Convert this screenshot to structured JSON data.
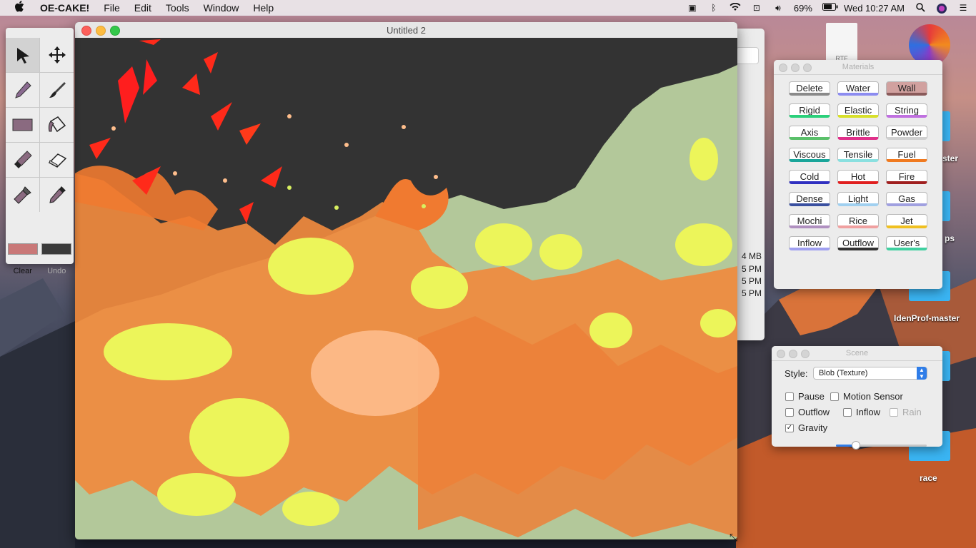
{
  "menubar": {
    "apple": "",
    "menus": [
      "OE-CAKE!",
      "File",
      "Edit",
      "Tools",
      "Window",
      "Help"
    ],
    "battery": "69%",
    "clock": "Wed 10:27 AM"
  },
  "desktop": {
    "labels": [
      "ster",
      "ps",
      "IdenProf-master",
      "race"
    ],
    "doc_badge": "RTF",
    "finder_texts": [
      "4 MB",
      "5 PM",
      "5 PM",
      "5 PM"
    ]
  },
  "tools": {
    "items": [
      "select-tool",
      "move-tool",
      "pencil-tool",
      "brush-tool",
      "rectangle-tool",
      "fill-tool",
      "knife-tool",
      "eraser-tool",
      "flashlight-tool",
      "dropper-tool"
    ],
    "primary_color": "#c97878",
    "secondary_color": "#3a3a3a",
    "clear_label": "Clear",
    "undo_label": "Undo"
  },
  "main_window": {
    "title": "Untitled 2"
  },
  "materials": {
    "title": "Materials",
    "buttons": [
      {
        "label": "Delete",
        "color": "#8a8a8a"
      },
      {
        "label": "Water",
        "color": "#8c8cf0"
      },
      {
        "label": "Wall",
        "color": "#8a5a5a"
      },
      {
        "label": "Rigid",
        "color": "#2ad07a"
      },
      {
        "label": "Elastic",
        "color": "#d8e02a"
      },
      {
        "label": "String",
        "color": "#c070e0"
      },
      {
        "label": "Axis",
        "color": "#5ac06a"
      },
      {
        "label": "Brittle",
        "color": "#e0308a"
      },
      {
        "label": "Powder",
        "color": "#d0d0d0"
      },
      {
        "label": "Viscous",
        "color": "#1aa59a"
      },
      {
        "label": "Tensile",
        "color": "#8ae0e0"
      },
      {
        "label": "Fuel",
        "color": "#f07a20"
      },
      {
        "label": "Cold",
        "color": "#3030c0"
      },
      {
        "label": "Hot",
        "color": "#e02020"
      },
      {
        "label": "Fire",
        "color": "#a02020"
      },
      {
        "label": "Dense",
        "color": "#3a50a0"
      },
      {
        "label": "Light",
        "color": "#a0d0f0"
      },
      {
        "label": "Gas",
        "color": "#a0a0e0"
      },
      {
        "label": "Mochi",
        "color": "#b090c0"
      },
      {
        "label": "Rice",
        "color": "#f0a0a0"
      },
      {
        "label": "Jet",
        "color": "#f0c020"
      },
      {
        "label": "Inflow",
        "color": "#a0a0f0"
      },
      {
        "label": "Outflow",
        "color": "#333333"
      },
      {
        "label": "User's",
        "color": "#40d0a0"
      }
    ],
    "active": "Wall"
  },
  "scene": {
    "title": "Scene",
    "style_label": "Style:",
    "style_value": "Blob (Texture)",
    "pause": "Pause",
    "motion_sensor": "Motion Sensor",
    "outflow": "Outflow",
    "inflow": "Inflow",
    "rain": "Rain",
    "gravity": "Gravity",
    "gravity_checked": true,
    "gravity_level": 0.2
  }
}
